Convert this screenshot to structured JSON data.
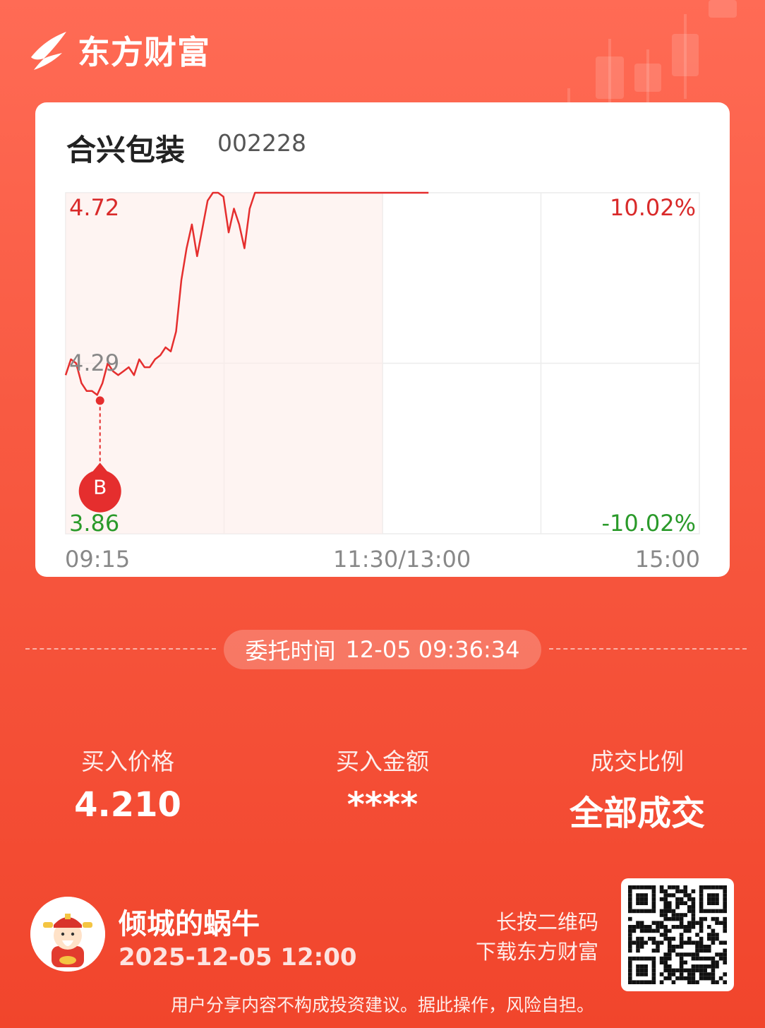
{
  "app": {
    "name": "东方财富",
    "logo_icon": "eastmoney-logo-icon"
  },
  "stock": {
    "name": "合兴包装",
    "code": "002228"
  },
  "chart_data": {
    "type": "line",
    "title": "",
    "y_labels": {
      "high": "4.72",
      "mid": "4.29",
      "low": "3.86"
    },
    "pct_labels": {
      "high": "10.02%",
      "low": "-10.02%"
    },
    "x_labels": [
      "09:15",
      "11:30/13:00",
      "15:00"
    ],
    "ylim": [
      3.86,
      4.72
    ],
    "prev_close": 4.29,
    "series": [
      {
        "values": [
          4.26,
          4.3,
          4.29,
          4.24,
          4.22,
          4.22,
          4.21,
          4.24,
          4.29,
          4.27,
          4.26,
          4.27,
          4.28,
          4.26,
          4.3,
          4.28,
          4.28,
          4.3,
          4.31,
          4.33,
          4.32,
          4.37,
          4.5,
          4.58,
          4.64,
          4.56,
          4.63,
          4.7,
          4.72,
          4.72,
          4.71,
          4.62,
          4.68,
          4.64,
          4.58,
          4.68,
          4.72,
          4.72,
          4.72,
          4.72,
          4.72,
          4.72,
          4.72,
          4.72,
          4.72,
          4.72,
          4.72,
          4.72,
          4.72,
          4.72,
          4.72,
          4.72,
          4.72,
          4.72,
          4.72,
          4.72,
          4.72,
          4.72,
          4.72,
          4.72,
          4.72,
          4.72,
          4.72,
          4.72,
          4.72,
          4.72,
          4.72,
          4.72,
          4.72,
          4.72
        ]
      }
    ],
    "marker": {
      "label": "B",
      "type": "buy",
      "price": 4.21
    },
    "colors": {
      "line": "#e52e2e",
      "up": "#d92a2a",
      "down": "#2a9a2a",
      "fill": "#fdecea"
    }
  },
  "order": {
    "label": "委托时间",
    "datetime": "12-05 09:36:34"
  },
  "stats": [
    {
      "label": "买入价格",
      "value": "4.210"
    },
    {
      "label": "买入金额",
      "value": "****"
    },
    {
      "label": "成交比例",
      "value": "全部成交"
    }
  ],
  "user": {
    "name": "倾城的蜗牛",
    "date": "2025-12-05 12:00",
    "avatar_icon": "cartoon-fortune-god-avatar"
  },
  "qr": {
    "line1": "长按二维码",
    "line2": "下载东方财富",
    "icon": "qr-code-icon"
  },
  "disclaimer": "用户分享内容不构成投资建议。据此操作，风险自担。"
}
